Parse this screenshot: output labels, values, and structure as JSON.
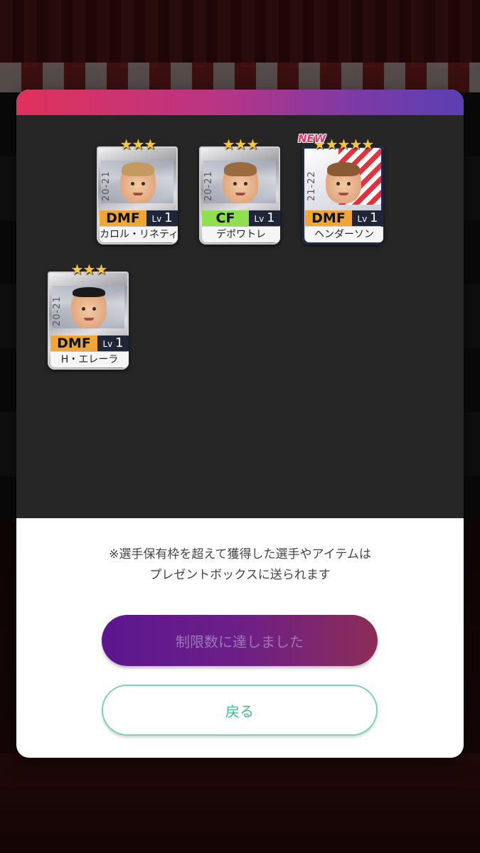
{
  "dialog": {
    "notice_line1": "※選手保有枠を超えて獲得した選手やアイテムは",
    "notice_line2": "プレゼントボックスに送られます",
    "limit_button": "制限数に達しました",
    "back_button": "戻る"
  },
  "cards": [
    {
      "season": "20-21",
      "position": "DMF",
      "lv_label": "Lv",
      "lv": "1",
      "name": "カロル・リネティ",
      "stars": "★★★",
      "badge": ""
    },
    {
      "season": "20-21",
      "position": "CF",
      "lv_label": "Lv",
      "lv": "1",
      "name": "デポワトレ",
      "stars": "★★★",
      "badge": ""
    },
    {
      "season": "21-22",
      "position": "DMF",
      "lv_label": "Lv",
      "lv": "1",
      "name": "ヘンダーソン",
      "stars": "★★★★★",
      "badge": "NEW"
    },
    {
      "season": "20-21",
      "position": "DMF",
      "lv_label": "Lv",
      "lv": "1",
      "name": "H・エレーラ",
      "stars": "★★★",
      "badge": ""
    }
  ],
  "colors": {
    "header_gradient_start": "#e0325a",
    "header_gradient_end": "#5a3fb4",
    "limit_button": "#6d1f87",
    "back_button_text": "#49b68e",
    "dmf": "#f0a534",
    "cf": "#8fe04f"
  }
}
